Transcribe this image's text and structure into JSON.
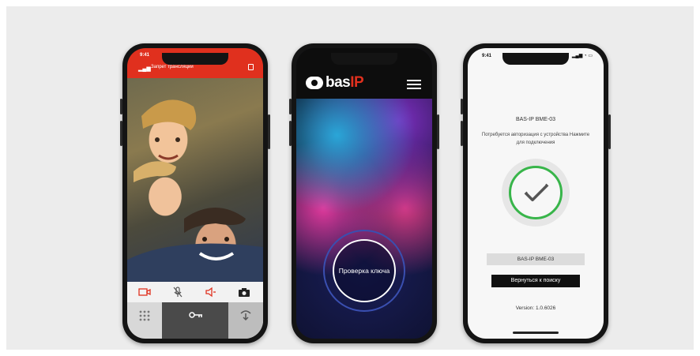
{
  "phone_call": {
    "time": "9:41",
    "status_label": "Запрет трансляции",
    "controls": [
      {
        "icon": "video-camera-icon"
      },
      {
        "icon": "microphone-muted-icon"
      },
      {
        "icon": "speaker-icon"
      },
      {
        "icon": "photo-camera-icon"
      }
    ],
    "bottom": [
      {
        "icon": "keypad-icon"
      },
      {
        "icon": "key-icon"
      },
      {
        "icon": "door-open-icon"
      }
    ],
    "accent": "#e0301e"
  },
  "phone_key": {
    "brand": "bas",
    "brand_accent": "IP",
    "check_button": "Проверка ключа"
  },
  "phone_auth": {
    "time": "9:41",
    "device_title": "BAS-IP BME-03",
    "message": "Потребуется авторизация с устройства Нажмите для подключения",
    "device_name": "BAS-IP BME-03",
    "back_button": "Вернуться к поиску",
    "version": "Version: 1.0.6026",
    "check_color": "#38b54a"
  }
}
